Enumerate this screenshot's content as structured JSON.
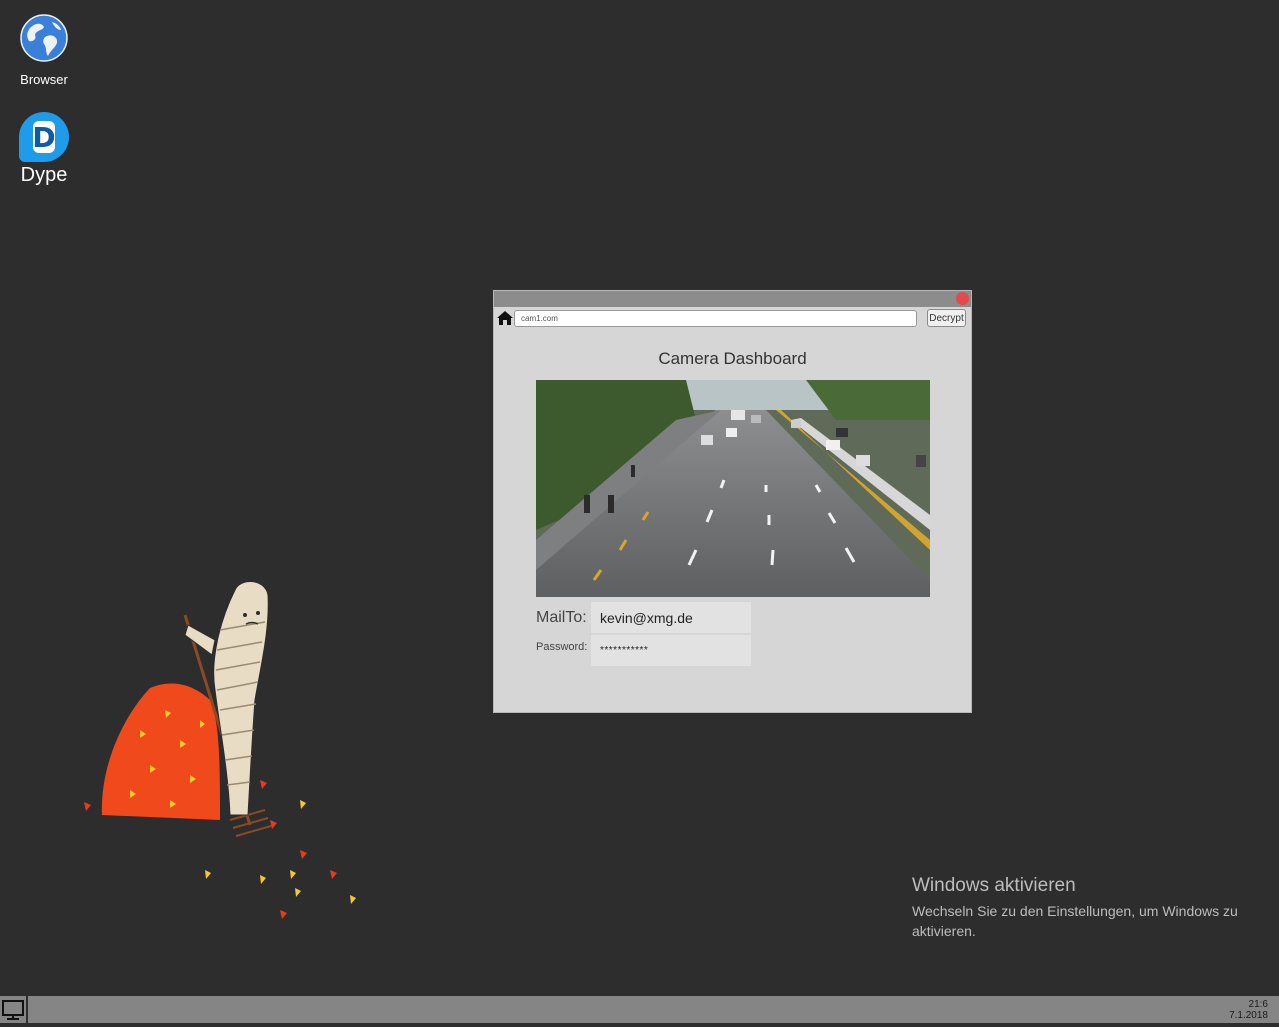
{
  "desktop": {
    "icons": [
      {
        "label": "Browser",
        "icon": "globe-icon"
      },
      {
        "label": "Dype",
        "icon": "dype-app-icon",
        "glyph": "D"
      }
    ]
  },
  "window": {
    "url": "cam1.com",
    "decrypt_label": "Decrypt",
    "page_title": "Camera Dashboard",
    "mailto_label": "MailTo:",
    "mailto_value": "kevin@xmg.de",
    "password_label": "Password:",
    "password_value": "***********"
  },
  "activation": {
    "title": "Windows aktivieren",
    "text": "Wechseln Sie zu den Einstellungen, um Windows zu aktivieren."
  },
  "taskbar": {
    "time": "21:6",
    "date": "7.1.2018"
  },
  "colors": {
    "desktop_bg": "#2d2d2d",
    "window_bg": "#d6d6d6",
    "close_button": "#e24b4b",
    "taskbar_bg": "#858585"
  }
}
